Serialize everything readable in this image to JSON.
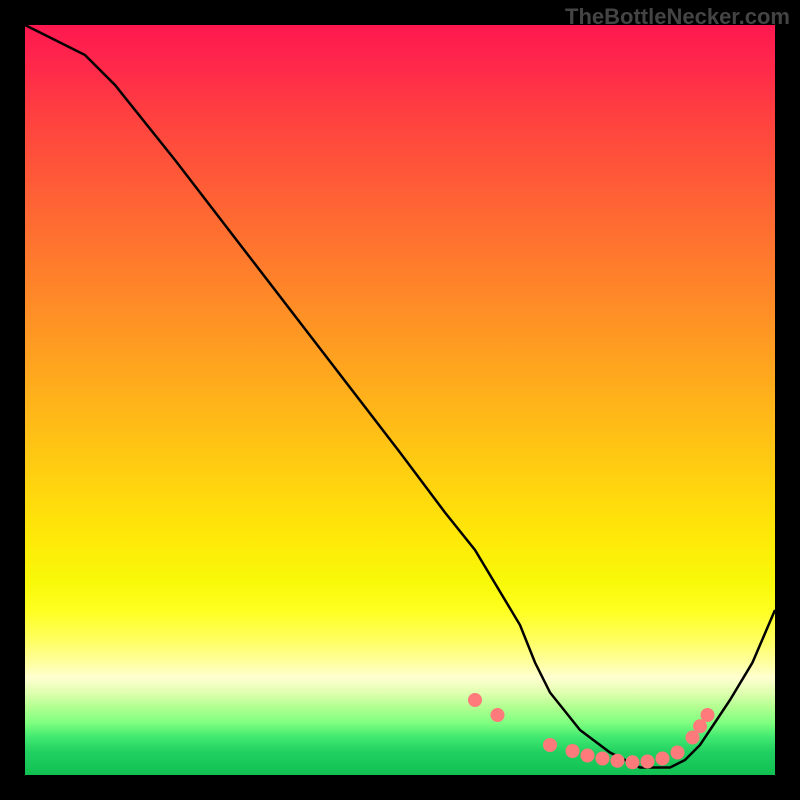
{
  "watermark": "TheBottleNecker.com",
  "chart_data": {
    "type": "line",
    "title": "",
    "xlabel": "",
    "ylabel": "",
    "xlim": [
      0,
      100
    ],
    "ylim": [
      0,
      100
    ],
    "series": [
      {
        "name": "curve",
        "x": [
          0,
          8,
          12,
          20,
          30,
          40,
          50,
          56,
          60,
          63,
          66,
          68,
          70,
          74,
          78,
          82,
          86,
          88,
          90,
          92,
          94,
          97,
          100
        ],
        "y": [
          100,
          96,
          92,
          82,
          69,
          56,
          43,
          35,
          30,
          25,
          20,
          15,
          11,
          6,
          3,
          1,
          1,
          2,
          4,
          7,
          10,
          15,
          22
        ]
      }
    ],
    "markers": {
      "name": "highlight-points",
      "color": "#ff7a7a",
      "x": [
        60,
        63,
        70,
        73,
        75,
        77,
        79,
        81,
        83,
        85,
        87,
        89,
        90,
        91
      ],
      "y": [
        10,
        8,
        4,
        3.2,
        2.6,
        2.2,
        1.9,
        1.7,
        1.8,
        2.2,
        3,
        5,
        6.5,
        8
      ]
    },
    "gradient_stops": [
      {
        "pos": 0,
        "color": "#ff1850"
      },
      {
        "pos": 50,
        "color": "#ffb020"
      },
      {
        "pos": 80,
        "color": "#ffff40"
      },
      {
        "pos": 100,
        "color": "#10c050"
      }
    ]
  }
}
